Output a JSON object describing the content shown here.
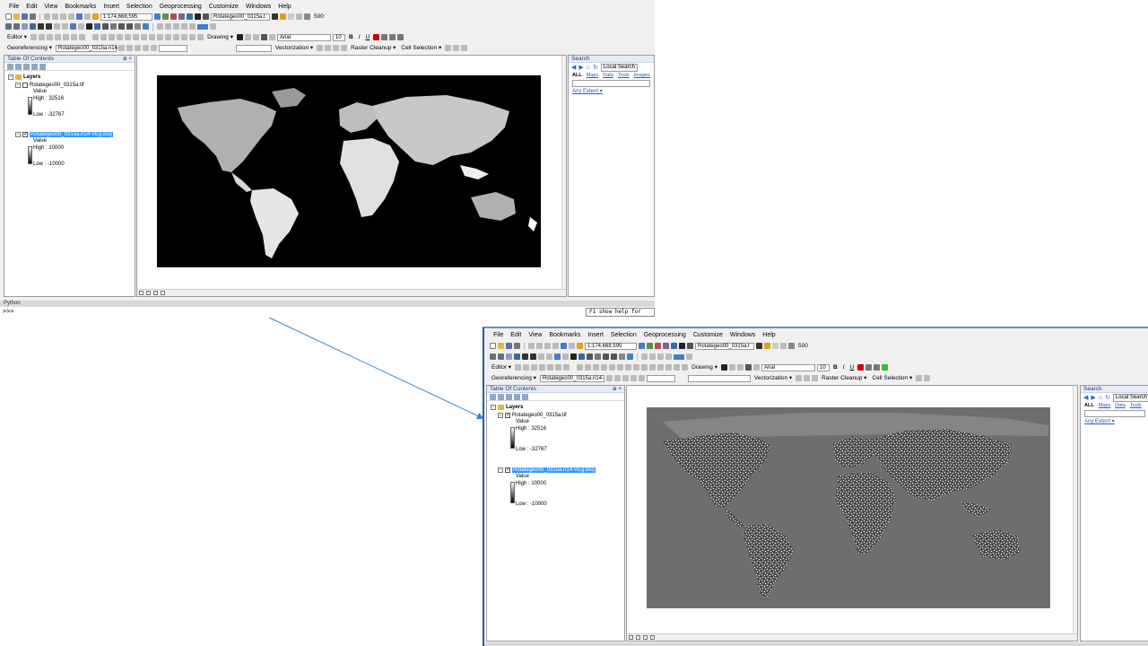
{
  "menu": [
    "File",
    "Edit",
    "View",
    "Bookmarks",
    "Insert",
    "Selection",
    "Geoprocessing",
    "Customize",
    "Windows",
    "Help"
  ],
  "toolbar": {
    "scale": "1:174,668,595",
    "layer_dropdown": "Rotategeo00_0315a.t",
    "editor_label": "Editor ▾",
    "drawing_label": "Drawing ▾",
    "font_name": "Arial",
    "font_size": "10",
    "zoom_value": "500",
    "georef_label": "Georeferencing ▾",
    "georef_layer": "Rotategeo00_0315a.n14-",
    "vectorization_label": "Vectorization ▾",
    "raster_cleanup_label": "Raster Cleanup ▾",
    "cell_selection_label": "Cell Selection ▾"
  },
  "toc": {
    "title": "Table Of Contents",
    "root": "Layers",
    "layers": [
      {
        "name": "Rotategeo00_0315a.tif",
        "value_label": "Value",
        "high": "High : 32516",
        "low": "Low : -32767"
      },
      {
        "name": "Rotategeo00_0315a.n14-VEg.bsq",
        "value_label": "Value",
        "high": "High : 10000",
        "low": "Low : -10000"
      }
    ]
  },
  "search": {
    "title": "Search",
    "local_search": "Local Search",
    "tabs": [
      "ALL",
      "Maps",
      "Data",
      "Tools",
      "Images"
    ],
    "extent": "Any Extent ▾"
  },
  "python": {
    "title": "Python",
    "prompt": ">>>",
    "help": "F1 show help for"
  },
  "colors": {
    "selection": "#3399ff",
    "map_before": "#000000",
    "map_after": "#6e6e6e",
    "arrow": "#3a86c8"
  }
}
